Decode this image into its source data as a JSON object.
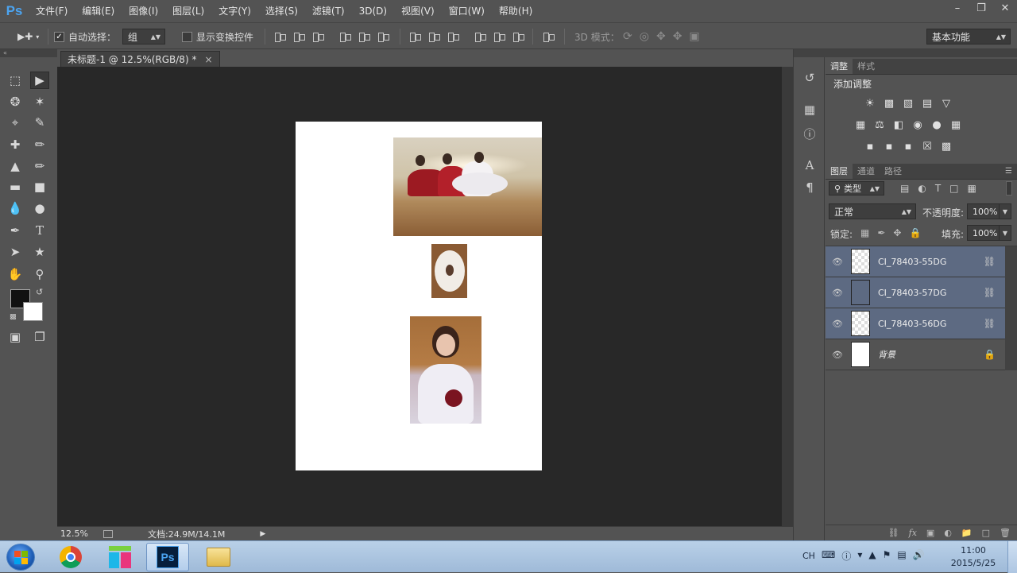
{
  "app": {
    "logo": "Ps"
  },
  "menu": [
    "文件(F)",
    "编辑(E)",
    "图像(I)",
    "图层(L)",
    "文字(Y)",
    "选择(S)",
    "滤镜(T)",
    "3D(D)",
    "视图(V)",
    "窗口(W)",
    "帮助(H)"
  ],
  "options": {
    "auto_select_label": "自动选择：",
    "auto_select_value": "组",
    "show_transform_label": "显示变换控件",
    "mode3d_label": "3D 模式：",
    "workspace": "基本功能"
  },
  "document": {
    "tab_title": "未标题-1 @ 12.5%(RGB/8) *",
    "zoom": "12.5%",
    "doc_info": "文档:24.9M/14.1M"
  },
  "adjust_panel": {
    "tabs": [
      "调整",
      "样式"
    ],
    "title": "添加调整"
  },
  "layers_panel": {
    "tabs": [
      "图层",
      "通道",
      "路径"
    ],
    "filter_label": "类型",
    "blend_mode": "正常",
    "opacity_label": "不透明度:",
    "opacity_value": "100%",
    "lock_label": "锁定:",
    "fill_label": "填充:",
    "fill_value": "100%",
    "layers": [
      {
        "name": "CI_78403-55DG",
        "selected": true
      },
      {
        "name": "CI_78403-57DG",
        "selected": true
      },
      {
        "name": "CI_78403-56DG",
        "selected": true
      },
      {
        "name": "背景",
        "selected": false
      }
    ]
  },
  "taskbar": {
    "ime": "CH",
    "time": "11:00",
    "date": "2015/5/25"
  },
  "colors": {
    "selection": "#5d6a82",
    "panel": "#535353",
    "canvas_bg": "#282828"
  }
}
